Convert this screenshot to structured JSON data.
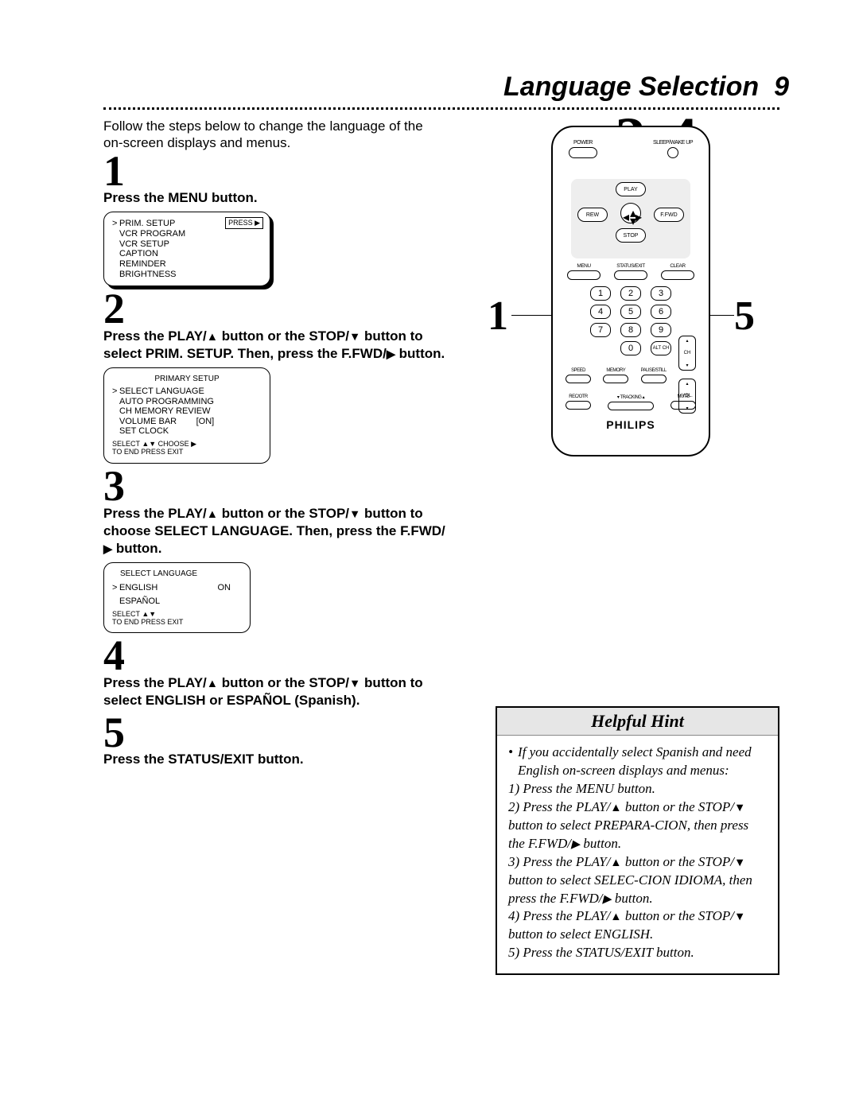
{
  "page": {
    "title": "Language Selection",
    "pageNumber": "9",
    "intro": "Follow the steps below to change the language of the on-screen displays and menus."
  },
  "step1": {
    "num": "1",
    "text": "Press the MENU button.",
    "screen": {
      "items": [
        "PRIM. SETUP",
        "VCR PROGRAM",
        "VCR SETUP",
        "CAPTION",
        "REMINDER",
        "BRIGHTNESS"
      ],
      "pressLabel": "PRESS ▶"
    }
  },
  "step2": {
    "num": "2",
    "text_pre": "Press the PLAY/",
    "text_mid1": " button or the STOP/",
    "text_mid2": " button to select PRIM. SETUP. Then, press the F.FWD/",
    "text_post": " button.",
    "screen": {
      "head": "PRIMARY SETUP",
      "items": [
        "SELECT LANGUAGE",
        "AUTO PROGRAMMING",
        "CH MEMORY REVIEW",
        "VOLUME BAR        [ON]",
        "SET CLOCK"
      ],
      "footer1": "SELECT ▲▼ CHOOSE ▶",
      "footer2": "TO  END  PRESS  EXIT"
    }
  },
  "step3": {
    "num": "3",
    "text_pre": "Press the PLAY/",
    "text_mid1": " button or the STOP/",
    "text_mid2": " button to choose SELECT LANGUAGE. Then, press the F.FWD/",
    "text_post": " button.",
    "screen": {
      "head": "SELECT LANGUAGE",
      "opt1": "ENGLISH",
      "opt1state": "ON",
      "opt2": "ESPAÑOL",
      "footer1": "SELECT ▲▼",
      "footer2": "TO  END  PRESS  EXIT"
    }
  },
  "step4": {
    "num": "4",
    "text_pre": "Press the PLAY/",
    "text_mid1": " button or the STOP/",
    "text_post": " button to select ENGLISH or ESPAÑOL (Spanish)."
  },
  "step5": {
    "num": "5",
    "text": "Press the STATUS/EXIT button."
  },
  "remote": {
    "bigRange": "2-4",
    "callout1": "1",
    "callout5": "5",
    "powerLabel": "POWER",
    "sleepLabel": "SLEEP/WAKE UP",
    "play": "PLAY",
    "rew": "REW",
    "ffwd": "F.FWD",
    "stop": "STOP",
    "menu": "MENU",
    "status": "STATUS/EXIT",
    "clear": "CLEAR",
    "num1": "1",
    "num2": "2",
    "num3": "3",
    "num4": "4",
    "num5": "5",
    "num6": "6",
    "num7": "7",
    "num8": "8",
    "num9": "9",
    "num0": "0",
    "altch": "ALT CH",
    "ch": "CH",
    "vol": "VOL.",
    "speed": "SPEED",
    "memory": "MEMORY",
    "pausestill": "PAUSE/STILL",
    "recotr": "REC/OTR",
    "tracking": "TRACKING",
    "mute": "MUTE",
    "brand": "PHILIPS"
  },
  "hint": {
    "title": "Helpful Hint",
    "lead": "If you accidentally select Spanish and need English on-screen displays and menus:",
    "l1": "1) Press the MENU button.",
    "l2a": "2) Press the PLAY/",
    "l2b": " button or the STOP/",
    "l2c": " button to select PREPARA-CION, then press the F.FWD/",
    "l2d": " button.",
    "l3a": "3) Press the PLAY/",
    "l3b": " button or the STOP/",
    "l3c": " button to select SELEC-CION IDIOMA, then press the F.FWD/",
    "l3d": " button.",
    "l4a": "4) Press the PLAY/",
    "l4b": " button or the STOP/",
    "l4c": " button to select ENGLISH.",
    "l5": "5) Press the STATUS/EXIT button."
  }
}
